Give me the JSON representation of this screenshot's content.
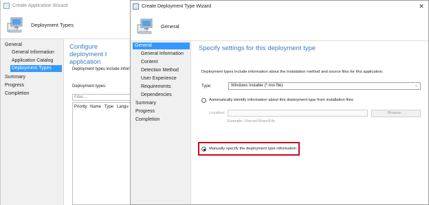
{
  "back_window": {
    "title": "Create Application Wizard",
    "header_label": "Deployment Types",
    "nav": [
      {
        "label": "General",
        "level": 0,
        "selected": false
      },
      {
        "label": "General Information",
        "level": 1,
        "selected": false
      },
      {
        "label": "Application Catalog",
        "level": 1,
        "selected": false
      },
      {
        "label": "Deployment Types",
        "level": 1,
        "selected": true
      },
      {
        "label": "Summary",
        "level": 0,
        "selected": false
      },
      {
        "label": "Progress",
        "level": 0,
        "selected": false
      },
      {
        "label": "Completion",
        "level": 0,
        "selected": false
      }
    ],
    "heading": "Configure deployment t application",
    "info": "Deployment types include informa",
    "deployment_types_label": "Deployment types:",
    "filter_placeholder": "Filter...",
    "grid_columns": [
      "Priority",
      "Name",
      "Type",
      "Langu"
    ]
  },
  "dialog": {
    "title": "Create Deployment Type Wizard",
    "close_glyph": "✕",
    "header_label": "General",
    "nav": [
      {
        "label": "General",
        "level": 0,
        "selected": true
      },
      {
        "label": "General Information",
        "level": 1,
        "selected": false
      },
      {
        "label": "Content",
        "level": 1,
        "selected": false
      },
      {
        "label": "Detection Method",
        "level": 1,
        "selected": false
      },
      {
        "label": "User Experience",
        "level": 1,
        "selected": false
      },
      {
        "label": "Requirements",
        "level": 1,
        "selected": false
      },
      {
        "label": "Dependencies",
        "level": 1,
        "selected": false
      },
      {
        "label": "Summary",
        "level": 0,
        "selected": false
      },
      {
        "label": "Progress",
        "level": 0,
        "selected": false
      },
      {
        "label": "Completion",
        "level": 0,
        "selected": false
      }
    ],
    "page_heading": "Specify settings for this deployment type",
    "description": "Deployment types include information about the installation method and source files for this application.",
    "type_label": "Type:",
    "type_value": "Windows Installer (*.msi file)",
    "auto_identify_label": "Automatically identify information about this deployment type from installation files",
    "auto_identify_checked": false,
    "location_label": "Location:",
    "location_value": "",
    "browse_label": "Browse...",
    "example_text": "Example: \\\\Server\\Share\\File",
    "manual_label": "Manually specify the deployment type information",
    "manual_checked": true
  },
  "colors": {
    "accent": "#3399ff",
    "heading": "#3b7bbf",
    "highlight_border": "#d0021b"
  }
}
